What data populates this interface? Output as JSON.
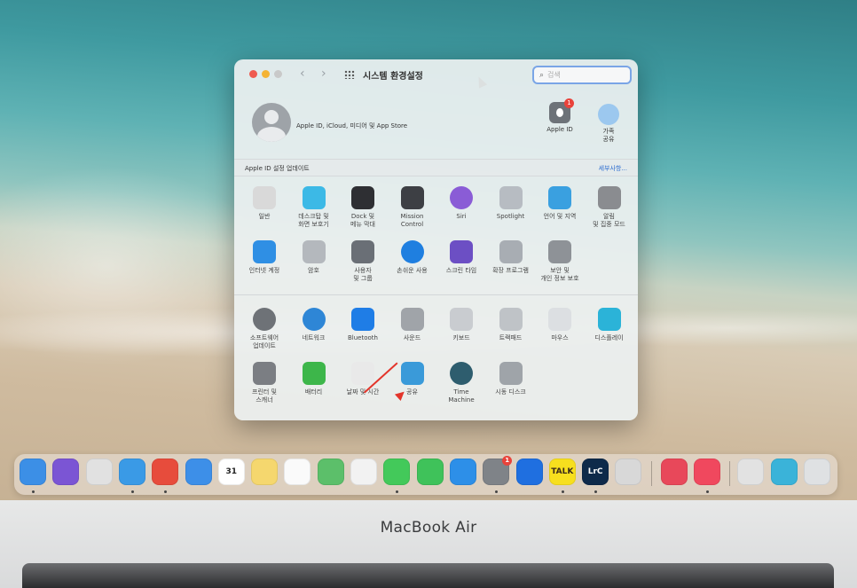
{
  "window": {
    "title": "시스템 환경설정",
    "search_placeholder": "검색",
    "account_text": "Apple ID, iCloud, 미디어 및 App Store",
    "top_items": [
      {
        "label": "Apple ID",
        "icon": "apple-id-icon",
        "badge": "1"
      },
      {
        "label": "가족\n공유",
        "icon": "family-icon"
      }
    ],
    "update_text": "Apple ID 설정 업데이트",
    "update_link": "세부사항...",
    "rows": [
      [
        {
          "label": "일반",
          "icon": "general-icon",
          "color": "#d9d9d9"
        },
        {
          "label": "데스크탑 및\n화면 보호기",
          "icon": "desktop-icon",
          "color": "#3cb9e6"
        },
        {
          "label": "Dock 및\n메뉴 막대",
          "icon": "dock-icon",
          "color": "#2e2f33"
        },
        {
          "label": "Mission\nControl",
          "icon": "mission-control-icon",
          "color": "#3d3f44"
        },
        {
          "label": "Siri",
          "icon": "siri-icon",
          "color": "#8a5cd6"
        },
        {
          "label": "Spotlight",
          "icon": "spotlight-icon",
          "color": "#b7bcc2"
        },
        {
          "label": "언어 및 지역",
          "icon": "language-icon",
          "color": "#3aa0e0"
        },
        {
          "label": "알림\n및 집중 모드",
          "icon": "notification-icon",
          "color": "#8a8c90"
        }
      ],
      [
        {
          "label": "인터넷 계정",
          "icon": "internet-accounts-icon",
          "color": "#2f8fe4"
        },
        {
          "label": "암호",
          "icon": "password-icon",
          "color": "#b4b8bd"
        },
        {
          "label": "사용자\n및 그룹",
          "icon": "users-icon",
          "color": "#6a6f76"
        },
        {
          "label": "손쉬운 사용",
          "icon": "accessibility-icon",
          "color": "#1f7fe0"
        },
        {
          "label": "스크린 타임",
          "icon": "screen-time-icon",
          "color": "#6c4fc4"
        },
        {
          "label": "확장 프로그램",
          "icon": "extensions-icon",
          "color": "#a8adb3"
        },
        {
          "label": "보안 및\n개인 정보 보호",
          "icon": "security-icon",
          "color": "#8e9297"
        }
      ],
      [
        {
          "label": "소프트웨어\n업데이트",
          "icon": "software-update-icon",
          "color": "#6e7277"
        },
        {
          "label": "네트워크",
          "icon": "network-icon",
          "color": "#2e86d6"
        },
        {
          "label": "Bluetooth",
          "icon": "bluetooth-icon",
          "color": "#1f7de6"
        },
        {
          "label": "사운드",
          "icon": "sound-icon",
          "color": "#a0a4a9"
        },
        {
          "label": "키보드",
          "icon": "keyboard-icon",
          "color": "#c9ccd0"
        },
        {
          "label": "트랙패드",
          "icon": "trackpad-icon",
          "color": "#bfc3c7"
        },
        {
          "label": "마우스",
          "icon": "mouse-icon",
          "color": "#dcdfe2"
        },
        {
          "label": "디스플레이",
          "icon": "display-icon",
          "color": "#2bb3d8"
        }
      ],
      [
        {
          "label": "프린터 및\n스캐너",
          "icon": "printer-icon",
          "color": "#7b7e83"
        },
        {
          "label": "배터리",
          "icon": "battery-icon",
          "color": "#3db64a"
        },
        {
          "label": "날짜 및 시간",
          "icon": "date-time-icon",
          "color": "#e9e9e9"
        },
        {
          "label": "공유",
          "icon": "sharing-icon",
          "color": "#3a9ad9"
        },
        {
          "label": "Time\nMachine",
          "icon": "time-machine-icon",
          "color": "#2e5d6e"
        },
        {
          "label": "시동 디스크",
          "icon": "startup-disk-icon",
          "color": "#9fa4a9"
        }
      ]
    ]
  },
  "dock": {
    "apps": [
      {
        "name": "finder",
        "color": "#3c8fe6",
        "running": true
      },
      {
        "name": "siri",
        "color": "#7b55d4",
        "running": false
      },
      {
        "name": "launchpad",
        "color": "#e1e1e1",
        "running": false
      },
      {
        "name": "safari",
        "color": "#3a9ae6",
        "running": true
      },
      {
        "name": "chrome",
        "color": "#e74c3c",
        "running": true
      },
      {
        "name": "mail",
        "color": "#3d8fe8",
        "running": false
      },
      {
        "name": "calendar",
        "color": "#ffffff",
        "running": false,
        "text": "31"
      },
      {
        "name": "notes",
        "color": "#f5d76e",
        "running": false
      },
      {
        "name": "reminders",
        "color": "#fafafa",
        "running": false
      },
      {
        "name": "maps",
        "color": "#5cbf6a",
        "running": false
      },
      {
        "name": "photos",
        "color": "#f2f2f2",
        "running": false
      },
      {
        "name": "messages",
        "color": "#43c95a",
        "running": true
      },
      {
        "name": "facetime",
        "color": "#3fc25a",
        "running": false
      },
      {
        "name": "app-store",
        "color": "#2d8fe8",
        "running": false
      },
      {
        "name": "system-preferences",
        "color": "#7f8388",
        "running": true,
        "badge": "1"
      },
      {
        "name": "teamviewer",
        "color": "#1f6fe0",
        "running": false
      },
      {
        "name": "kakaotalk",
        "color": "#f7df1e",
        "running": true,
        "text": "TALK"
      },
      {
        "name": "lightroom-classic",
        "color": "#0e2a4a",
        "running": true,
        "text": "LrC"
      },
      {
        "name": "unknown-app",
        "color": "#d8d8d8",
        "running": false
      },
      {
        "name": "creative-cloud",
        "color": "#e8485a",
        "running": false
      },
      {
        "name": "music",
        "color": "#f0485e",
        "running": true
      },
      {
        "name": "documents",
        "color": "#e2e2e2",
        "running": false
      },
      {
        "name": "downloads-folder",
        "color": "#3ab3d9",
        "running": false
      },
      {
        "name": "trash",
        "color": "#dfe1e3",
        "running": false
      }
    ]
  },
  "bezel": {
    "brand": "MacBook Air"
  }
}
